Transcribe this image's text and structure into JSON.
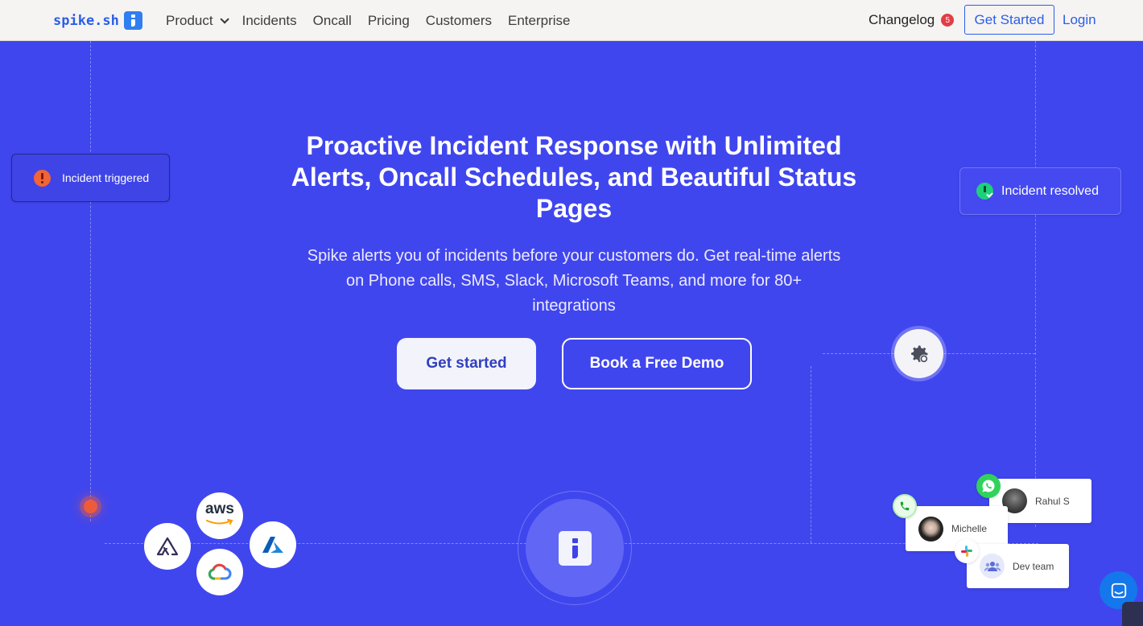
{
  "nav": {
    "logo_text": "spike.sh",
    "items": [
      {
        "label": "Product",
        "has_dropdown": true
      },
      {
        "label": "Incidents"
      },
      {
        "label": "Oncall"
      },
      {
        "label": "Pricing"
      },
      {
        "label": "Customers"
      },
      {
        "label": "Enterprise"
      }
    ],
    "changelog_label": "Changelog",
    "changelog_count": "5",
    "get_started_label": "Get Started",
    "login_label": "Login"
  },
  "hero": {
    "title": "Proactive Incident Response with Unlimited Alerts, Oncall Schedules, and Beautiful Status Pages",
    "subtitle": "Spike alerts you of incidents before your customers do. Get real-time alerts on Phone calls, SMS, Slack, Microsoft Teams, and more for 80+ integrations",
    "primary_button": "Get started",
    "secondary_button": "Book a Free Demo"
  },
  "status_pills": {
    "triggered": "Incident triggered",
    "resolved": "Incident resolved"
  },
  "integrations": {
    "aws_label": "aws",
    "icons": [
      "sentry-icon",
      "aws-icon",
      "azure-icon",
      "google-cloud-icon"
    ]
  },
  "people": {
    "rahul": "Rahul S",
    "michelle": "Michelle",
    "dev_team": "Dev team"
  },
  "colors": {
    "hero_bg": "#4046ee",
    "nav_bg": "#f6f3f3",
    "brand_blue": "#2a5fe6",
    "alert_orange": "#f16436",
    "resolved_green": "#1fd07a",
    "changelog_badge": "#e03e46"
  }
}
